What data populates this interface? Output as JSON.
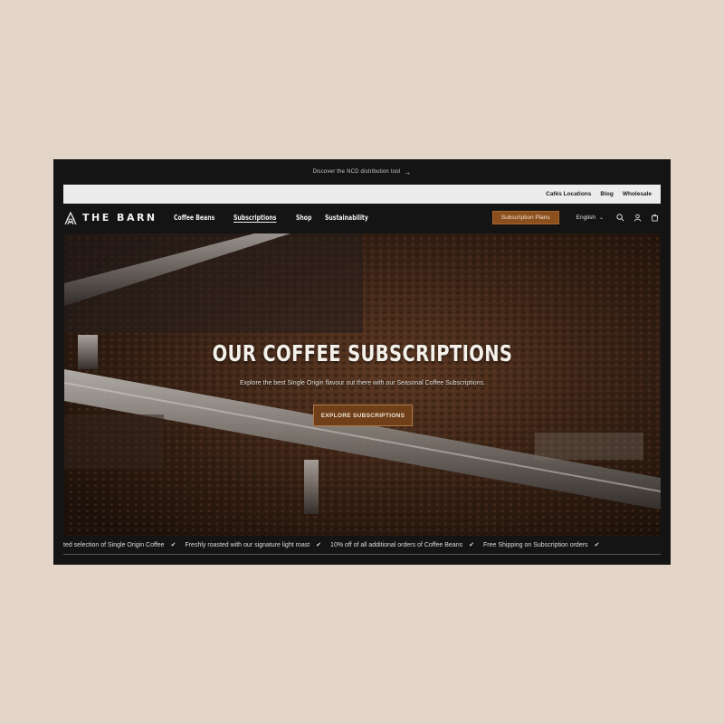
{
  "announcement": {
    "text": "Discover the NCD distribution tool",
    "arrow": "→"
  },
  "topbar": {
    "links": [
      "Cafés Locations",
      "Blog",
      "Wholesale"
    ]
  },
  "header": {
    "logo_text": "THE BARN",
    "nav": [
      {
        "label": "Coffee Beans",
        "active": false
      },
      {
        "label": "Subscriptions",
        "active": true
      },
      {
        "label": "Shop",
        "active": false
      },
      {
        "label": "Sustainability",
        "active": false
      }
    ],
    "cta_label": "Subscription Plans",
    "language": "English",
    "icons": [
      "search-icon",
      "account-icon",
      "cart-icon"
    ]
  },
  "hero": {
    "title": "OUR COFFEE SUBSCRIPTIONS",
    "subtitle": "Explore the best Single Origin flavour out there with our Seasonal Coffee Subscriptions.",
    "button_label": "EXPLORE SUBSCRIPTIONS"
  },
  "marquee": {
    "items": [
      "ted selection of Single Origin Coffee",
      "Freshly roasted with our signature light roast",
      "10% off of all additional orders of Coffee Beans",
      "Free Shipping on Subscription orders"
    ],
    "check": "✔"
  },
  "colors": {
    "page_bg": "#e3d6c9",
    "frame_bg": "#141414",
    "accent": "#8b4f1e"
  }
}
